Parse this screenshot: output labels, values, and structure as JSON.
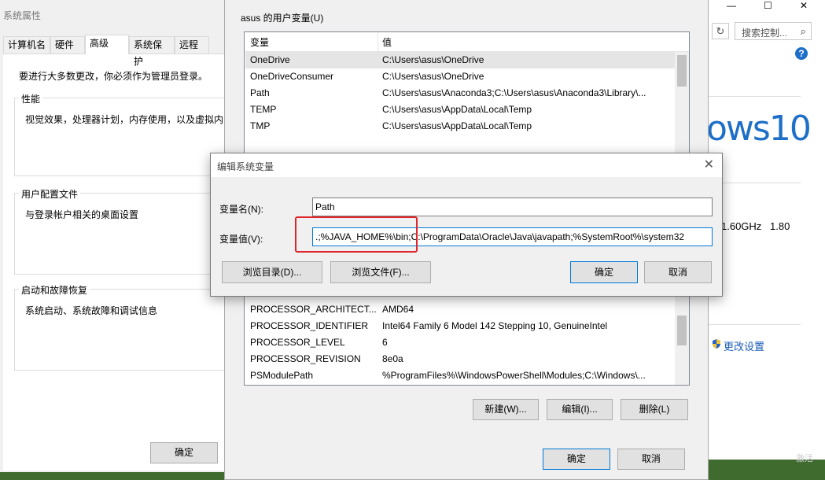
{
  "background_window": {
    "window_controls": {
      "minimize": "—",
      "maximize": "☐",
      "close": "✕"
    },
    "search_placeholder": "搜索控制...",
    "search_icon_glyph": "⌕",
    "refresh_icon_glyph": "↻",
    "help_glyph": "?",
    "windows_brand": "ows10",
    "cpu_speed": "1.60GHz",
    "cpu_speed2": "1.80",
    "change_settings_link": "更改设置"
  },
  "system_properties": {
    "title": "系统属性",
    "tabs": [
      {
        "label": "计算机名"
      },
      {
        "label": "硬件"
      },
      {
        "label": "高级"
      },
      {
        "label": "系统保护"
      },
      {
        "label": "远程"
      }
    ],
    "admin_note": "要进行大多数更改，你必须作为管理员登录。",
    "groups": [
      {
        "label": "性能",
        "text": "视觉效果，处理器计划，内存使用，以及虚拟内"
      },
      {
        "label": "用户配置文件",
        "text": "与登录帐户相关的桌面设置"
      },
      {
        "label": "启动和故障恢复",
        "text": "系统启动、系统故障和调试信息"
      }
    ],
    "ok_label": "确定"
  },
  "env_dialog": {
    "user_vars_label": "asus 的用户变量(U)",
    "columns": {
      "name": "变量",
      "value": "值"
    },
    "user_vars": [
      {
        "name": "OneDrive",
        "value": "C:\\Users\\asus\\OneDrive"
      },
      {
        "name": "OneDriveConsumer",
        "value": "C:\\Users\\asus\\OneDrive"
      },
      {
        "name": "Path",
        "value": "C:\\Users\\asus\\Anaconda3;C:\\Users\\asus\\Anaconda3\\Library\\..."
      },
      {
        "name": "TEMP",
        "value": "C:\\Users\\asus\\AppData\\Local\\Temp"
      },
      {
        "name": "TMP",
        "value": "C:\\Users\\asus\\AppData\\Local\\Temp"
      }
    ],
    "system_vars": [
      {
        "name": "PROCESSOR_ARCHITECT...",
        "value": "AMD64"
      },
      {
        "name": "PROCESSOR_IDENTIFIER",
        "value": "Intel64 Family 6 Model 142 Stepping 10, GenuineIntel"
      },
      {
        "name": "PROCESSOR_LEVEL",
        "value": "6"
      },
      {
        "name": "PROCESSOR_REVISION",
        "value": "8e0a"
      },
      {
        "name": "PSModulePath",
        "value": "%ProgramFiles%\\WindowsPowerShell\\Modules;C:\\Windows\\..."
      }
    ],
    "buttons": {
      "new": "新建(W)...",
      "edit": "编辑(I)...",
      "delete": "删除(L)"
    },
    "ok_label": "确定",
    "cancel_label": "取消"
  },
  "edit_dialog": {
    "title": "编辑系统变量",
    "close_glyph": "✕",
    "name_label": "变量名(N):",
    "value_label": "变量值(V):",
    "name_value": "Path",
    "value_value": ".;%JAVA_HOME%\\bin;C:\\ProgramData\\Oracle\\Java\\javapath;%SystemRoot%\\system32",
    "browse_dir": "浏览目录(D)...",
    "browse_file": "浏览文件(F)...",
    "ok_label": "确定",
    "cancel_label": "取消",
    "highlight_color": "#e0262a"
  },
  "taskbar_hint": "激活"
}
